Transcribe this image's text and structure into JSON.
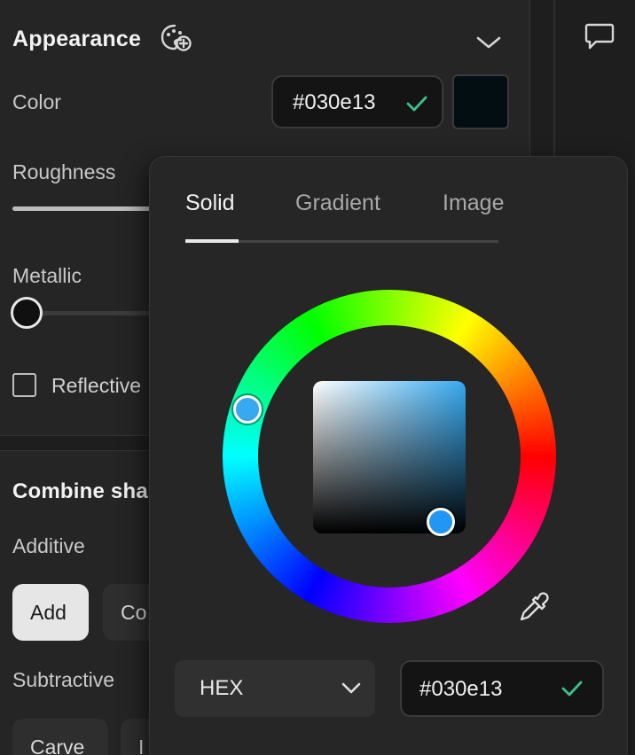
{
  "appearance": {
    "title": "Appearance",
    "color_label": "Color",
    "color_hex": "#030e13",
    "roughness_label": "Roughness",
    "roughness_value": 0.5,
    "metallic_label": "Metallic",
    "metallic_value": 0,
    "reflective_label": "Reflective",
    "reflective_checked": false
  },
  "combine": {
    "title": "Combine sha",
    "additive_label": "Additive",
    "add_button": "Add",
    "second_button": "Co",
    "subtractive_label": "Subtractive",
    "carve_button": "Carve",
    "fourth_button": "I"
  },
  "picker": {
    "tabs": [
      {
        "label": "Solid",
        "active": true
      },
      {
        "label": "Gradient",
        "active": false
      },
      {
        "label": "Image",
        "active": false
      }
    ],
    "mode": "HEX",
    "hex_value": "#030e13",
    "hue_handle_color": "#36a9f0",
    "sv_handle_color": "#36a9f0"
  },
  "colors": {
    "accent_check": "#3ec08a",
    "selected_color": "#030e13"
  },
  "icons": {
    "style_add": "palette-add-icon",
    "collapse": "chevron-down-icon",
    "comment": "comment-icon",
    "eyedropper": "eyedropper-icon",
    "confirm": "check-icon"
  }
}
